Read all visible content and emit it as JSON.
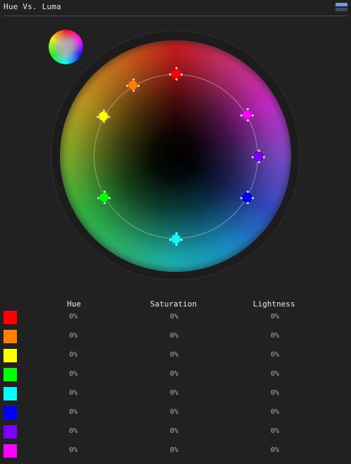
{
  "panel": {
    "title": "Hue Vs. Luma"
  },
  "icons": {
    "menu": "menu-icon",
    "color_picker": "color-picker-icon"
  },
  "table": {
    "columns": [
      "Hue",
      "Saturation",
      "Lightness"
    ],
    "rows": [
      {
        "name": "red",
        "color": "#ff0000",
        "hue": "0%",
        "saturation": "0%",
        "lightness": "0%"
      },
      {
        "name": "orange",
        "color": "#ff7f00",
        "hue": "0%",
        "saturation": "0%",
        "lightness": "0%"
      },
      {
        "name": "yellow",
        "color": "#ffff00",
        "hue": "0%",
        "saturation": "0%",
        "lightness": "0%"
      },
      {
        "name": "green",
        "color": "#00ff00",
        "hue": "0%",
        "saturation": "0%",
        "lightness": "0%"
      },
      {
        "name": "cyan",
        "color": "#00ffff",
        "hue": "0%",
        "saturation": "0%",
        "lightness": "0%"
      },
      {
        "name": "blue",
        "color": "#0000ff",
        "hue": "0%",
        "saturation": "0%",
        "lightness": "0%"
      },
      {
        "name": "purple",
        "color": "#7f00ff",
        "hue": "0%",
        "saturation": "0%",
        "lightness": "0%"
      },
      {
        "name": "magenta",
        "color": "#ff00ff",
        "hue": "0%",
        "saturation": "0%",
        "lightness": "0%"
      }
    ]
  },
  "wheel": {
    "handles": [
      {
        "name": "red",
        "color": "#ff0000",
        "angle_deg": 0
      },
      {
        "name": "orange",
        "color": "#ff7f00",
        "angle_deg": 329
      },
      {
        "name": "yellow",
        "color": "#ffff00",
        "angle_deg": 299
      },
      {
        "name": "green",
        "color": "#00ff00",
        "angle_deg": 240
      },
      {
        "name": "cyan",
        "color": "#00ffff",
        "angle_deg": 180
      },
      {
        "name": "blue",
        "color": "#0000ff",
        "angle_deg": 120
      },
      {
        "name": "purple",
        "color": "#7f00ff",
        "angle_deg": 90
      },
      {
        "name": "magenta",
        "color": "#ff00ff",
        "angle_deg": 60
      }
    ]
  }
}
